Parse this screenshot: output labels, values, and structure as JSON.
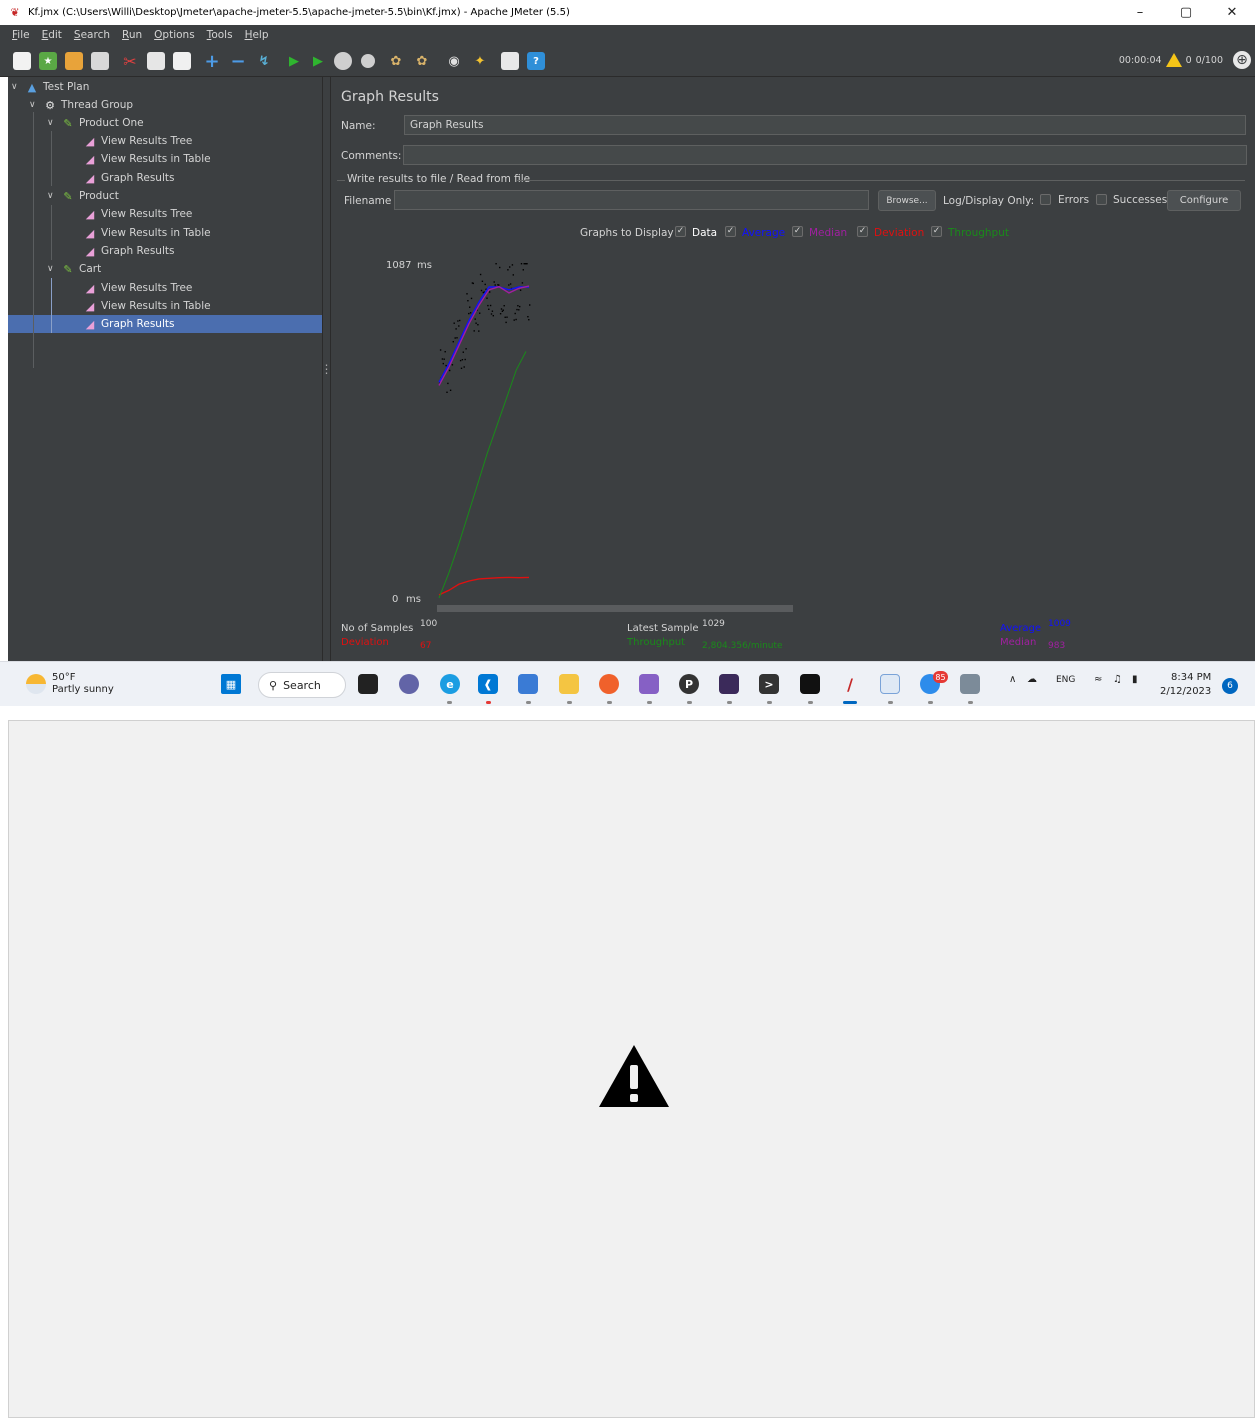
{
  "window": {
    "title": "Kf.jmx (C:\\Users\\Willi\\Desktop\\Jmeter\\apache-jmeter-5.5\\apache-jmeter-5.5\\bin\\Kf.jmx) - Apache JMeter (5.5)",
    "minimize": "–",
    "maximize": "▢",
    "close": "✕"
  },
  "menu": [
    "File",
    "Edit",
    "Search",
    "Run",
    "Options",
    "Tools",
    "Help"
  ],
  "status": {
    "elapsed": "00:00:04",
    "warnings": "0",
    "threads": "0/100"
  },
  "tree": {
    "nodes": [
      {
        "label": "Test Plan"
      },
      {
        "label": "Thread Group"
      },
      {
        "label": "Product One"
      },
      {
        "label": "View Results Tree"
      },
      {
        "label": "View Results in Table"
      },
      {
        "label": "Graph Results"
      },
      {
        "label": "Product"
      },
      {
        "label": "View Results Tree"
      },
      {
        "label": "View Results in Table"
      },
      {
        "label": "Graph Results"
      },
      {
        "label": "Cart"
      },
      {
        "label": "View Results Tree"
      },
      {
        "label": "View Results in Table"
      },
      {
        "label": "Graph Results"
      }
    ]
  },
  "panel": {
    "title": "Graph Results",
    "name_label": "Name:",
    "name_value": "Graph Results",
    "comments_label": "Comments:",
    "comments_value": "",
    "file_section": "Write results to file / Read from file",
    "filename_label": "Filename",
    "filename_value": "",
    "browse": "Browse...",
    "log_display": "Log/Display Only:",
    "errors": "Errors",
    "successes": "Successes",
    "configure": "Configure",
    "graphs_to_display": "Graphs to Display",
    "toggle_data": "Data",
    "toggle_average": "Average",
    "toggle_median": "Median",
    "toggle_deviation": "Deviation",
    "toggle_throughput": "Throughput"
  },
  "chart_data": {
    "type": "line",
    "y_top_label": "1087",
    "y_bottom_label": "0",
    "y_unit": "ms",
    "ylim": [
      0,
      1087
    ],
    "samples": 100,
    "series": [
      {
        "name": "Average",
        "color": "#1010ff",
        "values": [
          700,
          760,
          830,
          900,
          960,
          1009,
          1009,
          1000,
          1009,
          1009
        ]
      },
      {
        "name": "Median",
        "color": "#a020a0",
        "values": [
          690,
          750,
          820,
          890,
          950,
          1000,
          1010,
          990,
          1005,
          1012
        ]
      },
      {
        "name": "Deviation",
        "color": "#e01010",
        "values": [
          10,
          25,
          45,
          55,
          62,
          64,
          66,
          67,
          66,
          67
        ]
      },
      {
        "name": "Throughput",
        "color": "#1a8a1a",
        "values": [
          0,
          80,
          170,
          270,
          370,
          470,
          560,
          650,
          740,
          800
        ]
      }
    ]
  },
  "stats": {
    "samples_label": "No of Samples",
    "samples_value": "100",
    "latest_label": "Latest Sample",
    "latest_value": "1029",
    "average_label": "Average",
    "average_value": "1009",
    "deviation_label": "Deviation",
    "deviation_value": "67",
    "throughput_label": "Throughput",
    "throughput_value": "2,804.356/minute",
    "median_label": "Median",
    "median_value": "983"
  },
  "taskbar": {
    "temp": "50°F",
    "weather": "Partly sunny",
    "search": "Search",
    "badge": "85",
    "lang": "ENG",
    "time": "8:34 PM",
    "date": "2/12/2023",
    "notifications": "6"
  },
  "colors": {
    "bg": "#3c3f41",
    "selection": "#4b6eaf",
    "average": "#1010ff",
    "median": "#a020a0",
    "deviation": "#e01010",
    "throughput": "#1a8a1a"
  }
}
